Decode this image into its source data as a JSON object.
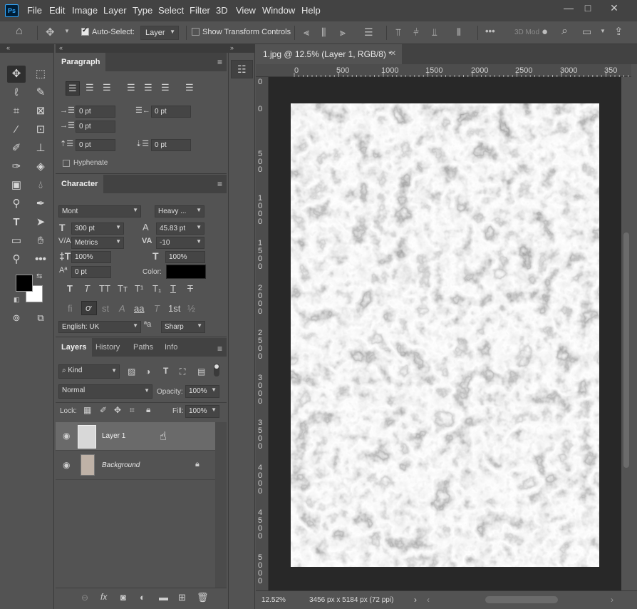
{
  "app": {
    "logo_text": "Ps"
  },
  "menu": [
    "File",
    "Edit",
    "Image",
    "Layer",
    "Type",
    "Select",
    "Filter",
    "3D",
    "View",
    "Window",
    "Help"
  ],
  "window_controls": {
    "minimize": "—",
    "maximize": "□",
    "close": "✕"
  },
  "options": {
    "auto_select_label": "Auto-Select:",
    "auto_select_checked": true,
    "auto_select_target": "Layer",
    "show_transform_label": "Show Transform Controls",
    "show_transform_checked": false,
    "more": "•••",
    "mode3d_label": "3D Mod"
  },
  "paragraph": {
    "tab_label": "Paragraph",
    "indent_left": "0 pt",
    "indent_right": "0 pt",
    "indent_first": "0 pt",
    "space_before": "0 pt",
    "space_after": "0 pt",
    "hyphenate_label": "Hyphenate",
    "hyphenate_checked": false
  },
  "character": {
    "tab_label": "Character",
    "font_family": "Mont",
    "font_style": "Heavy ...",
    "font_size": "300 pt",
    "leading": "45.83 pt",
    "kerning": "Metrics",
    "tracking": "-10",
    "vertical_scale": "100%",
    "horizontal_scale": "100%",
    "baseline_shift": "0 pt",
    "color_label": "Color:",
    "color_value": "#000000",
    "language": "English: UK",
    "aa_label": "ªa",
    "antialias": "Sharp",
    "type_style_buttons": [
      "T",
      "T",
      "TT",
      "Tт",
      "T¹",
      "T₁",
      "T",
      "T"
    ],
    "opentype_buttons": [
      "fi",
      "ơ",
      "st",
      "A",
      "aa",
      "T",
      "1st",
      "½"
    ]
  },
  "layers_panel": {
    "tabs": [
      "Layers",
      "History",
      "Paths",
      "Info"
    ],
    "active_tab": "Layers",
    "filter_kind": "Kind",
    "blend_mode": "Normal",
    "opacity_label": "Opacity:",
    "opacity": "100%",
    "lock_label": "Lock:",
    "fill_label": "Fill:",
    "fill": "100%",
    "layers": [
      {
        "name": "Layer 1",
        "visible": true,
        "selected": true,
        "locked": false
      },
      {
        "name": "Background",
        "visible": true,
        "selected": false,
        "locked": true
      }
    ]
  },
  "document": {
    "tab_title": "1.jpg @ 12.5% (Layer 1, RGB/8) *",
    "close": "✕",
    "zoom": "12.52%",
    "doc_info": "3456 px x 5184 px (72 ppi)",
    "ruler_h_labels": [
      "0",
      "500",
      "1000",
      "1500",
      "2000",
      "2500",
      "3000",
      "350"
    ],
    "ruler_v_labels": [
      "0",
      "0",
      "500",
      "1000",
      "1500",
      "2000",
      "2500",
      "3000",
      "3500",
      "4000",
      "4500",
      "5000"
    ]
  },
  "colors": {
    "foreground": "#000000",
    "background": "#ffffff",
    "ui_dark": "#434343",
    "ui_mid": "#535353",
    "pasteboard": "#282828",
    "accent": "#31a8ff"
  },
  "tool_icons": [
    "move-icon",
    "marquee-icon",
    "lasso-icon",
    "quick-select-icon",
    "crop-icon",
    "frame-icon",
    "eyedropper-icon",
    "patch-icon",
    "brush-icon",
    "stamp-icon",
    "history-brush-icon",
    "eraser-icon",
    "gradient-icon",
    "blur-icon",
    "dodge-icon",
    "pen-icon",
    "type-icon",
    "path-select-icon",
    "rectangle-icon",
    "hand-icon",
    "zoom-icon",
    "more-tools-icon"
  ]
}
